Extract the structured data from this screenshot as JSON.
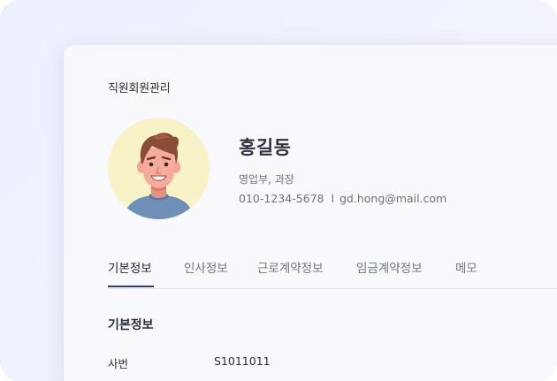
{
  "page_title": "직원회원관리",
  "profile": {
    "name": "홍길동",
    "department_position": "영업부, 과장",
    "phone": "010-1234-5678",
    "separator": "l",
    "email": "gd.hong@mail.com",
    "avatar_icon": "male-avatar-icon"
  },
  "tabs": [
    {
      "label": "기본정보",
      "active": true
    },
    {
      "label": "인사정보",
      "active": false
    },
    {
      "label": "근로계약정보",
      "active": false
    },
    {
      "label": "임금계약정보",
      "active": false
    },
    {
      "label": "메모",
      "active": false
    }
  ],
  "section": {
    "title": "기본정보",
    "fields": [
      {
        "label": "사번",
        "value": "S1011011"
      }
    ]
  },
  "colors": {
    "accent": "#2a3d9a",
    "avatar_bg": "#f8f3c6",
    "backdrop": "#eef1fd",
    "card_bg": "#f7f9fc"
  }
}
